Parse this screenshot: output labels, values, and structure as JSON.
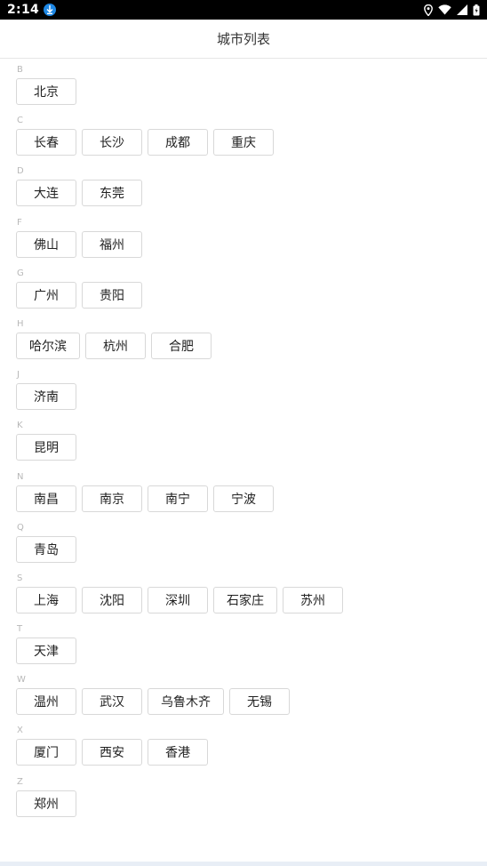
{
  "status_bar": {
    "time": "2:14"
  },
  "header": {
    "title": "城市列表"
  },
  "groups": [
    {
      "letter": "B",
      "cities": [
        "北京"
      ]
    },
    {
      "letter": "C",
      "cities": [
        "长春",
        "长沙",
        "成都",
        "重庆"
      ]
    },
    {
      "letter": "D",
      "cities": [
        "大连",
        "东莞"
      ]
    },
    {
      "letter": "F",
      "cities": [
        "佛山",
        "福州"
      ]
    },
    {
      "letter": "G",
      "cities": [
        "广州",
        "贵阳"
      ]
    },
    {
      "letter": "H",
      "cities": [
        "哈尔滨",
        "杭州",
        "合肥"
      ]
    },
    {
      "letter": "J",
      "cities": [
        "济南"
      ]
    },
    {
      "letter": "K",
      "cities": [
        "昆明"
      ]
    },
    {
      "letter": "N",
      "cities": [
        "南昌",
        "南京",
        "南宁",
        "宁波"
      ]
    },
    {
      "letter": "Q",
      "cities": [
        "青岛"
      ]
    },
    {
      "letter": "S",
      "cities": [
        "上海",
        "沈阳",
        "深圳",
        "石家庄",
        "苏州"
      ]
    },
    {
      "letter": "T",
      "cities": [
        "天津"
      ]
    },
    {
      "letter": "W",
      "cities": [
        "温州",
        "武汉",
        "乌鲁木齐",
        "无锡"
      ]
    },
    {
      "letter": "X",
      "cities": [
        "厦门",
        "西安",
        "香港"
      ]
    },
    {
      "letter": "Z",
      "cities": [
        "郑州"
      ]
    }
  ]
}
